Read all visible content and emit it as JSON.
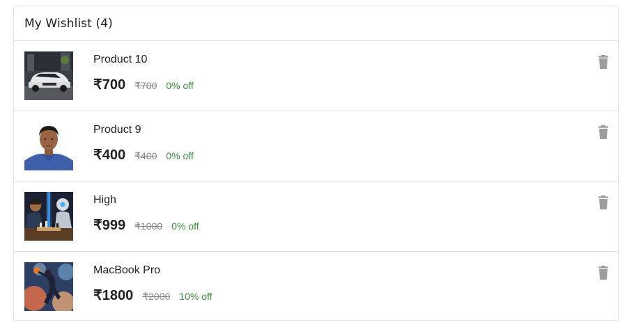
{
  "wishlist": {
    "title": "My Wishlist (4)",
    "items": [
      {
        "name": "Product 10",
        "price": "₹700",
        "mrp": "₹700",
        "discount": "0% off",
        "image_icon": "car-photo"
      },
      {
        "name": "Product 9",
        "price": "₹400",
        "mrp": "₹400",
        "discount": "0% off",
        "image_icon": "portrait-photo"
      },
      {
        "name": "High",
        "price": "₹999",
        "mrp": "₹1000",
        "discount": "0% off",
        "image_icon": "chess-robot-photo"
      },
      {
        "name": "MacBook Pro",
        "price": "₹1800",
        "mrp": "₹2000",
        "discount": "10% off",
        "image_icon": "basketball-art-photo"
      }
    ]
  },
  "colors": {
    "discount_green": "#388e3c",
    "mrp_grey": "#878787",
    "delete_icon_grey": "#9e9e9e",
    "text_dark": "#212121",
    "border": "#e0e0e0"
  }
}
